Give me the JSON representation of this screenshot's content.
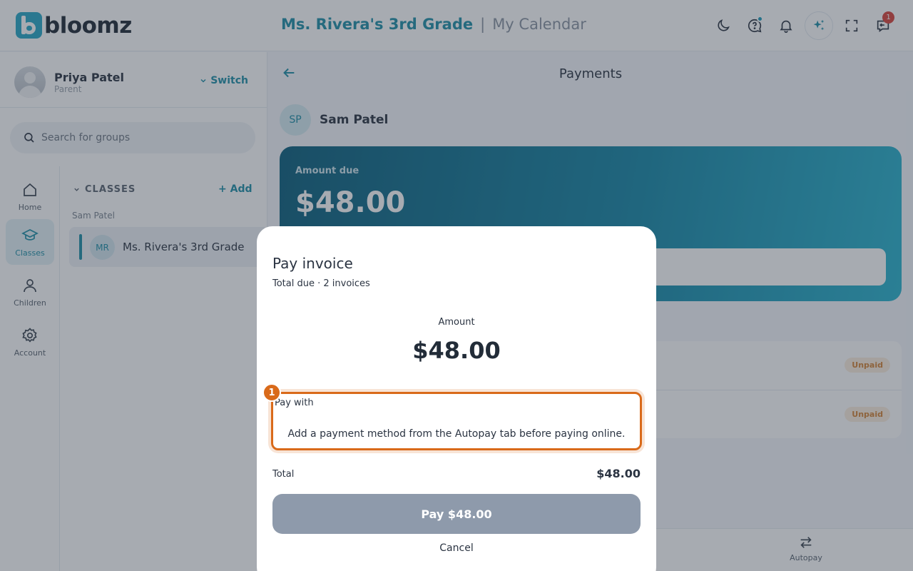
{
  "header": {
    "logo_text": "bloomz",
    "group_title": "Ms. Rivera's 3rd Grade",
    "separator": "|",
    "page_title": "My Calendar",
    "icons": [
      "moon-icon",
      "help-chat-icon",
      "bell-icon",
      "sparkle-icon",
      "fullscreen-icon",
      "inbox-icon"
    ],
    "inbox_badge": "1"
  },
  "sidebar": {
    "profile": {
      "name": "Priya Patel",
      "role": "Parent",
      "switch_label": "Switch"
    },
    "search": {
      "placeholder": "Search for groups"
    },
    "rail": [
      {
        "label": "Home",
        "icon": "home-icon"
      },
      {
        "label": "Classes",
        "icon": "graduation-cap-icon",
        "active": true
      },
      {
        "label": "Children",
        "icon": "person-icon"
      },
      {
        "label": "Account",
        "icon": "gear-icon"
      }
    ],
    "classes": {
      "heading": "CLASSES",
      "add_label": "Add",
      "child_name": "Sam Patel",
      "items": [
        {
          "initials": "MR",
          "name": "Ms. Rivera's 3rd Grade"
        }
      ]
    }
  },
  "main": {
    "title": "Payments",
    "student": {
      "initials": "SP",
      "name": "Sam Patel"
    },
    "amount_due_label": "Amount due",
    "amount_due_value": "$48.00",
    "invoices": [
      {
        "status": "Unpaid"
      },
      {
        "status": "Unpaid"
      }
    ],
    "bottom_tab": {
      "label": "Autopay",
      "icon": "swap-arrows-icon"
    }
  },
  "modal": {
    "title": "Pay invoice",
    "subtitle": "Total due · 2 invoices",
    "amount_label": "Amount",
    "amount_value": "$48.00",
    "pay_with_label": "Pay with",
    "pay_with_message": "Add a payment method from the Autopay tab before paying online.",
    "step_marker": "1",
    "total_label": "Total",
    "total_value": "$48.00",
    "pay_button": "Pay $48.00",
    "cancel_button": "Cancel"
  },
  "colors": {
    "accent": "#1f8fa8",
    "highlight": "#d96a1a",
    "pay_button_disabled": "#8e9aab",
    "unpaid_badge_text": "#d48436",
    "notification_badge": "#d9443c"
  }
}
